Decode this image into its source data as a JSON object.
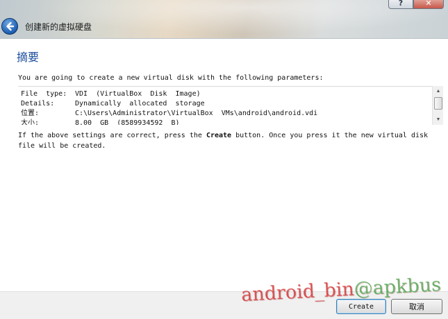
{
  "window": {
    "title": "创建新的虚拟硬盘",
    "help_label": "?",
    "close_label": "✕"
  },
  "page": {
    "heading": "摘要",
    "intro": "You are going to create a new virtual disk with the following parameters:"
  },
  "params": [
    {
      "key": "File  type:",
      "value": "VDI  (VirtualBox  Disk  Image)"
    },
    {
      "key": "Details:",
      "value": "Dynamically  allocated  storage"
    },
    {
      "key": "位置:",
      "value": "C:\\Users\\Administrator\\VirtualBox  VMs\\android\\android.vdi"
    },
    {
      "key": "大小:",
      "value": "8.00  GB  (8589934592  B)"
    }
  ],
  "notice": {
    "before": "If the above settings are correct, press the ",
    "bold": "Create",
    "after": " button. Once you press it the new virtual disk file will be created."
  },
  "buttons": {
    "create": "Create",
    "cancel": "取消"
  },
  "watermark": {
    "red": "android_bin",
    "green": "@apkbus"
  },
  "colors": {
    "heading": "#1c4e9c",
    "footer_bg": "#f0f0f0",
    "watermark_red": "#d62828",
    "watermark_green": "#40a846"
  }
}
